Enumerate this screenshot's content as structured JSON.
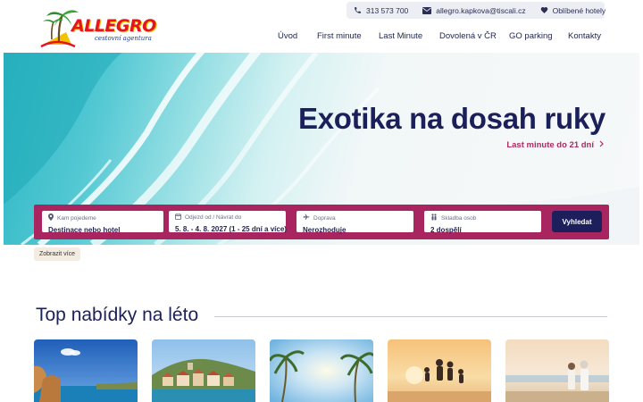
{
  "contact": {
    "phone": "313 573 700",
    "email": "allegro.kapkova@tiscali.cz",
    "favorites": "Oblíbené hotely",
    "icons": [
      "phone-icon",
      "envelope-icon",
      "heart-icon"
    ]
  },
  "logo": {
    "name": "ALLEGRO",
    "tagline": "cestovní agentura"
  },
  "nav": {
    "items": [
      {
        "label": "Úvod"
      },
      {
        "label": "First minute"
      },
      {
        "label": "Last Minute"
      },
      {
        "label": "Dovolená v ČR"
      },
      {
        "label": "GO parking"
      },
      {
        "label": "Kontakty"
      }
    ]
  },
  "hero": {
    "title": "Exotika na dosah ruky",
    "link": "Last minute do 21 dní"
  },
  "search": {
    "fields": [
      {
        "label": "Kam pojedeme",
        "value": "Destinace nebo hotel",
        "icon": "map-pin-icon"
      },
      {
        "label": "Odjezd od / Návrat do",
        "value": "5. 8. - 4. 8. 2027 (1 - 25 dní a více)",
        "icon": "calendar-icon"
      },
      {
        "label": "Doprava",
        "value": "Nerozhoduje",
        "icon": "airplane-icon"
      },
      {
        "label": "Skladba osob",
        "value": "2 dospělí",
        "icon": "people-icon"
      }
    ],
    "button": "Vyhledat",
    "more": "Zobrazit více"
  },
  "section": {
    "title": "Top nabídky na léto"
  },
  "colors": {
    "brand_navy": "#1c1f5b",
    "brand_magenta": "#a8255f",
    "link_pink": "#b02a62",
    "logo_red": "#e3161d",
    "logo_yellow": "#f3c300"
  }
}
